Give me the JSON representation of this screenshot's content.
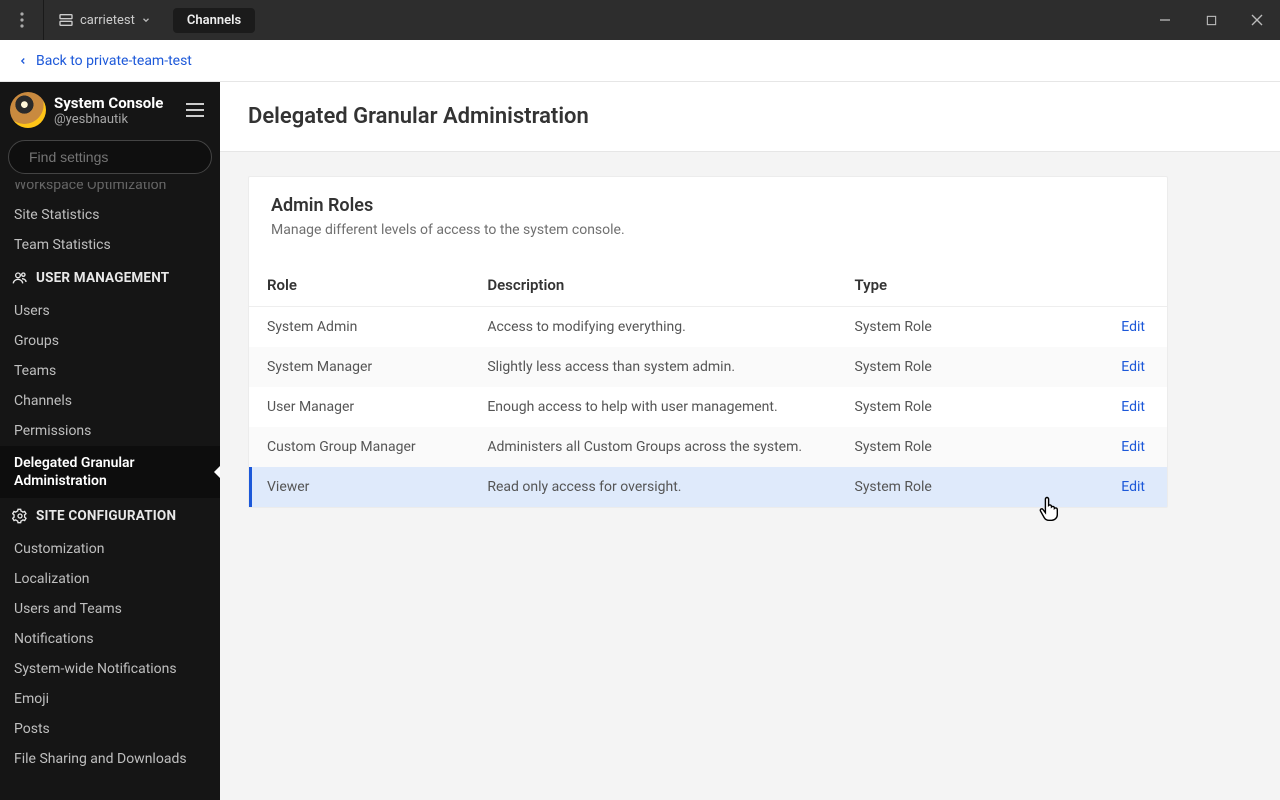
{
  "titlebar": {
    "workspace": "carrietest",
    "tab": "Channels"
  },
  "backbar": {
    "label": "Back to private-team-test"
  },
  "sidebar": {
    "title": "System Console",
    "handle": "@yesbhautik",
    "search_placeholder": "Find settings",
    "pre_cut": "Workspace Optimization",
    "items_top": [
      "Site Statistics",
      "Team Statistics"
    ],
    "section_user_mgmt": "USER MANAGEMENT",
    "user_mgmt_items": [
      "Users",
      "Groups",
      "Teams",
      "Channels",
      "Permissions"
    ],
    "active_item": "Delegated Granular Administration",
    "section_site_config": "SITE CONFIGURATION",
    "site_config_items": [
      "Customization",
      "Localization",
      "Users and Teams",
      "Notifications",
      "System-wide Notifications",
      "Emoji",
      "Posts",
      "File Sharing and Downloads"
    ]
  },
  "page": {
    "title": "Delegated Granular Administration",
    "card_title": "Admin Roles",
    "card_sub": "Manage different levels of access to the system console.",
    "columns": {
      "role": "Role",
      "description": "Description",
      "type": "Type"
    },
    "edit_label": "Edit",
    "rows": [
      {
        "role": "System Admin",
        "description": "Access to modifying everything.",
        "type": "System Role"
      },
      {
        "role": "System Manager",
        "description": "Slightly less access than system admin.",
        "type": "System Role"
      },
      {
        "role": "User Manager",
        "description": "Enough access to help with user management.",
        "type": "System Role"
      },
      {
        "role": "Custom Group Manager",
        "description": "Administers all Custom Groups across the system.",
        "type": "System Role"
      },
      {
        "role": "Viewer",
        "description": "Read only access for oversight.",
        "type": "System Role"
      }
    ]
  }
}
